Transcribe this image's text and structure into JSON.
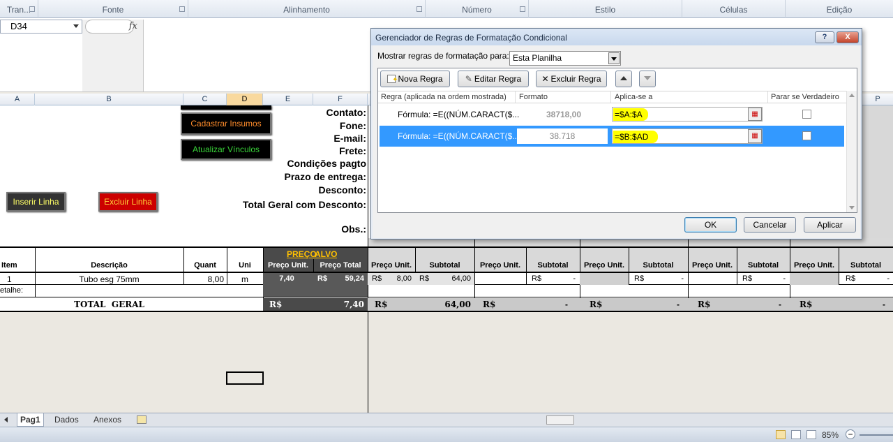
{
  "ribbon": {
    "groups": [
      "Tran...",
      "Fonte",
      "Alinhamento",
      "Número",
      "Estilo",
      "Células",
      "Edição"
    ]
  },
  "formula_bar": {
    "name_box": "D34",
    "fx": "fx"
  },
  "columns": [
    "A",
    "B",
    "C",
    "D",
    "E",
    "F",
    "P"
  ],
  "sheet": {
    "buttons": {
      "cadastrar": "Cadastrar Insumos",
      "atualizar": "Atualizar Vínculos",
      "inserir": "Inserir Linha",
      "excluir": "Excluir Linha"
    },
    "labels": [
      "Contato:",
      "Fone:",
      "E-mail:",
      "Frete:",
      "Condições pagto",
      "Prazo de entrega:",
      "Desconto:",
      "Total Geral com Desconto:",
      "Obs.:"
    ],
    "preco_alvo": [
      "PREÇO",
      "ALVO"
    ],
    "table_headers": [
      "Item",
      "Descrição",
      "Quant",
      "Uni",
      "Preço Unit.",
      "Preço Total",
      "Preço Unit.",
      "Subtotal",
      "Preço Unit.",
      "Subtotal",
      "Preço Unit.",
      "Subtotal",
      "Preço Unit.",
      "Subtotal",
      "Preço Unit.",
      "Subtotal"
    ],
    "row1": {
      "item": "1",
      "descricao": "Tubo esg 75mm",
      "quant": "8,00",
      "uni": "m",
      "preco_unit": "7,40",
      "preco_total_cur": "R$",
      "preco_total": "59,24",
      "s1_unit_cur": "R$",
      "s1_unit": "8,00",
      "s1_sub_cur": "R$",
      "s1_sub": "64,00",
      "s2_sub_cur": "R$",
      "s2_sub": "-",
      "s3_sub_cur": "R$",
      "s3_sub": "-",
      "s4_sub_cur": "R$",
      "s4_sub": "-",
      "s5_sub_cur": "R$",
      "s5_sub": "-"
    },
    "detalhe": "etalhe:",
    "total": {
      "label": "TOTAL  GERAL",
      "cur": "R$",
      "alvo": "7,40",
      "s1": "64,00",
      "dash": "-"
    }
  },
  "dialog": {
    "title": "Gerenciador de Regras de Formatação Condicional",
    "help": "?",
    "close": "X",
    "show_label": "Mostrar regras de formatação para:",
    "show_value": "Esta Planilha",
    "toolbar": {
      "nova": "Nova Regra",
      "editar": "Editar Regra",
      "excluir": "Excluir Regra"
    },
    "headers": {
      "regra": "Regra (aplicada na ordem mostrada)",
      "formato": "Formato",
      "aplica": "Aplica-se a",
      "parar": "Parar se Verdadeiro"
    },
    "rules": [
      {
        "regra": "Fórmula: =E((NÚM.CARACT($...",
        "formato": "38718,00",
        "aplica": "=$A:$A"
      },
      {
        "regra": "Fórmula: =E((NÚM.CARACT($...",
        "formato": "38.718",
        "aplica": "=$B:$AD"
      }
    ],
    "ok": "OK",
    "cancelar": "Cancelar",
    "aplicar": "Aplicar"
  },
  "tabs": [
    "Pag1",
    "Dados",
    "Anexos"
  ],
  "status": {
    "zoom": "85%"
  },
  "colors": {
    "selection_blue": "#3399ff",
    "highlight_yellow": "#ffff00",
    "excluir_red": "#cc0000"
  }
}
